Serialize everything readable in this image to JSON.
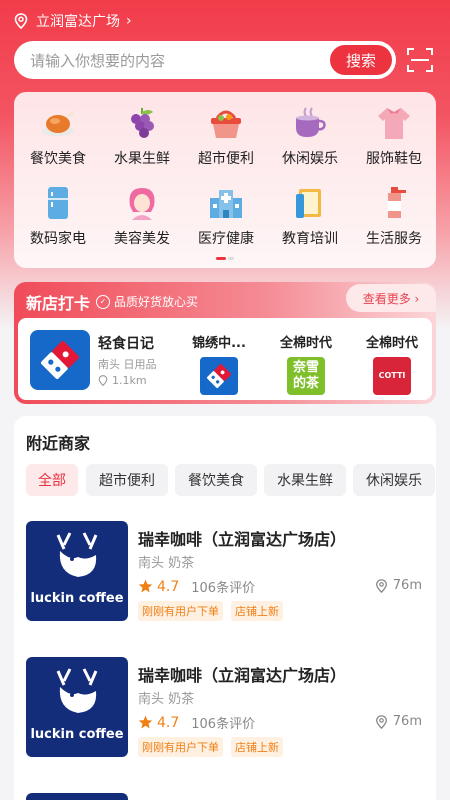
{
  "location": {
    "name": "立润富达广场"
  },
  "search": {
    "placeholder": "请输入你想要的内容",
    "button": "搜索"
  },
  "categories": [
    {
      "label": "餐饮美食",
      "icon": "roast-chicken-icon"
    },
    {
      "label": "水果生鲜",
      "icon": "grapes-icon"
    },
    {
      "label": "超市便利",
      "icon": "basket-icon"
    },
    {
      "label": "休闲娱乐",
      "icon": "coffee-cup-icon"
    },
    {
      "label": "服饰鞋包",
      "icon": "clothing-icon"
    },
    {
      "label": "数码家电",
      "icon": "fridge-icon"
    },
    {
      "label": "美容美发",
      "icon": "hair-person-icon"
    },
    {
      "label": "医疗健康",
      "icon": "hospital-icon"
    },
    {
      "label": "教育培训",
      "icon": "book-icon"
    },
    {
      "label": "生活服务",
      "icon": "bottle-icon"
    }
  ],
  "new_shops": {
    "title": "新店打卡",
    "subtitle": "品质好货放心买",
    "more": "查看更多 ›",
    "featured": {
      "name": "轻食日记",
      "category": "南头 日用品",
      "distance": "1.1km"
    },
    "others": [
      {
        "name": "锦绣中...",
        "logo_text": ""
      },
      {
        "name": "全棉时代",
        "logo_text": "奈雪的茶"
      },
      {
        "name": "全棉时代",
        "logo_text": "COTTI"
      }
    ]
  },
  "nearby": {
    "title": "附近商家",
    "tabs": [
      "全部",
      "超市便利",
      "餐饮美食",
      "水果生鲜",
      "休闲娱乐"
    ],
    "shops": [
      {
        "logo_text": "luckin coffee",
        "name": "瑞幸咖啡（立润富达广场店）",
        "area": "南头 奶茶",
        "rating": "4.7",
        "reviews": "106条评价",
        "distance": "76m",
        "tags": [
          "刚刚有用户下单",
          "店铺上新"
        ]
      },
      {
        "logo_text": "luckin coffee",
        "name": "瑞幸咖啡（立润富达广场店）",
        "area": "南头 奶茶",
        "rating": "4.7",
        "reviews": "106条评价",
        "distance": "76m",
        "tags": [
          "刚刚有用户下单",
          "店铺上新"
        ]
      }
    ]
  },
  "colors": {
    "primary": "#ee3340",
    "rating": "#f07f14",
    "luckin_blue": "#142d7a"
  }
}
